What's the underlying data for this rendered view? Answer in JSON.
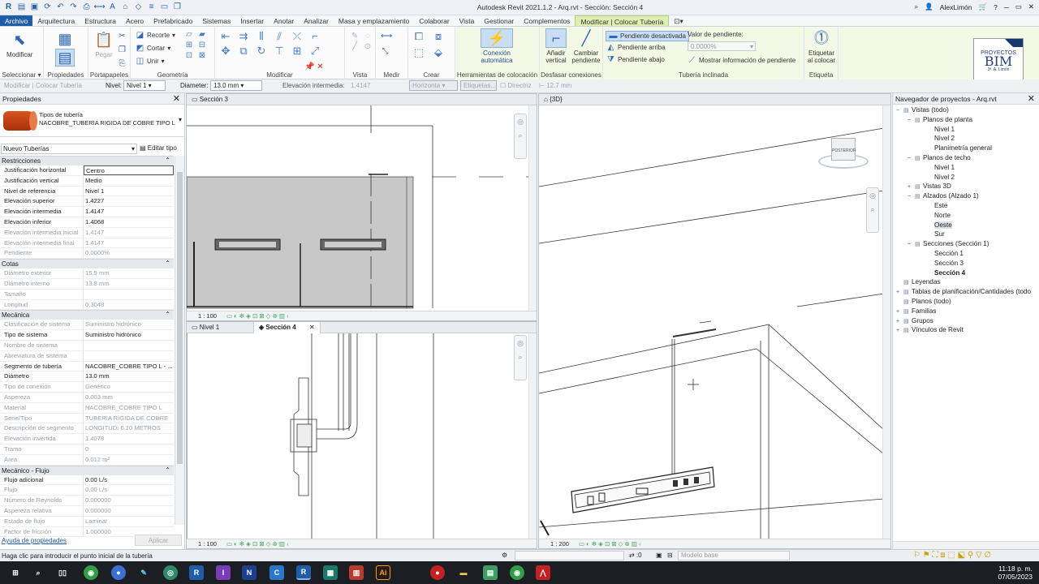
{
  "app": {
    "title": "Autodesk Revit 2021.1.2 - Arq.rvt - Sección: Sección 4",
    "user": "AlexLimón"
  },
  "menu": [
    "Archivo",
    "Arquitectura",
    "Estructura",
    "Acero",
    "Prefabricado",
    "Sistemas",
    "Insertar",
    "Anotar",
    "Analizar",
    "Masa y emplazamiento",
    "Colaborar",
    "Vista",
    "Gestionar",
    "Complementos",
    "Modificar | Colocar Tubería"
  ],
  "ribbon": {
    "modificar": "Modificar",
    "seleccionar": "Seleccionar",
    "propiedades": "Propiedades",
    "portapapeles": "Portapapeles",
    "pegar": "Pegar",
    "recorte": "Recorte",
    "cortar": "Cortar",
    "unir": "Unir",
    "geometria": "Geometría",
    "modificar_grp": "Modificar",
    "vista": "Vista",
    "medir": "Medir",
    "crear": "Crear",
    "conexion_auto": "Conexión automática",
    "herramientas": "Herramientas de colocación",
    "anadir_vertical": "Añadir vertical",
    "cambiar_pendiente": "Cambiar pendiente",
    "desfasar": "Desfasar conexiones",
    "pend_desactivada": "Pendiente desactivada",
    "pend_arriba": "Pendiente arriba",
    "pend_abajo": "Pendiente abajo",
    "valor_pendiente": "Valor de pendiente:",
    "valor_pendiente_val": "0.0000%",
    "mostrar_info": "Mostrar información de pendiente",
    "tuberia_inclinada": "Tubería inclinada",
    "etiquetar": "Etiquetar al colocar",
    "etiqueta": "Etiqueta",
    "logo_line1": "PROYECTOS",
    "logo_line2": "BIM",
    "logo_line3": "3ª. A. Limón"
  },
  "optbar": {
    "context": "Modificar | Colocar Tubería",
    "nivel_label": "Nivel:",
    "nivel": "Nivel 1",
    "diam_label": "Diameter:",
    "diam": "13.0 mm",
    "elev_label": "Elevación intermedia:",
    "elev": "1.4147",
    "horiz": "Horizonta",
    "etiq": "Etiquetas...",
    "directriz": "Directriz",
    "len": "12.7 mm"
  },
  "props": {
    "title": "Propiedades",
    "type_family": "Tipos de tubería",
    "type_name": "NACOBRE_TUBERIA RIGIDA DE COBRE TIPO L",
    "filter": "Nuevo Tuberías",
    "edit_type": "Editar tipo",
    "sections": [
      {
        "name": "Restricciones",
        "rows": [
          [
            "Justificación horizontal",
            "Centro",
            0,
            1
          ],
          [
            "Justificación vertical",
            "Medio",
            0,
            0
          ],
          [
            "Nivel de referencia",
            "Nivel 1",
            0,
            0
          ],
          [
            "Elevación superior",
            "1.4227",
            0,
            0
          ],
          [
            "Elevación intermedia",
            "1.4147",
            0,
            0
          ],
          [
            "Elevación inferior",
            "1.4068",
            0,
            0
          ],
          [
            "Elevación intermedia inicial",
            "1.4147",
            1,
            0
          ],
          [
            "Elevación intermedia final",
            "1.4147",
            1,
            0
          ],
          [
            "Pendiente",
            "0.0000%",
            1,
            0
          ]
        ]
      },
      {
        "name": "Cotas",
        "rows": [
          [
            "Diámetro exterior",
            "15.9 mm",
            1,
            0
          ],
          [
            "Diámetro interno",
            "13.8 mm",
            1,
            0
          ],
          [
            "Tamaño",
            "",
            1,
            0
          ],
          [
            "Longitud",
            "0.3048",
            1,
            0
          ]
        ]
      },
      {
        "name": "Mecánica",
        "rows": [
          [
            "Clasificación de sistema",
            "Suministro hidrónico",
            1,
            0
          ],
          [
            "Tipo de sistema",
            "Suministro hidrónico",
            0,
            0
          ],
          [
            "Nombre de sistema",
            "",
            1,
            0
          ],
          [
            "Abreviatura de sistema",
            "",
            1,
            0
          ],
          [
            "Segmento de tubería",
            "NACOBRE_COBRE TIPO L - ...",
            0,
            0
          ],
          [
            "Diámetro",
            "13.0 mm",
            0,
            0
          ],
          [
            "Tipo de conexión",
            "Genérico",
            1,
            0
          ],
          [
            "Aspereza",
            "0.003 mm",
            1,
            0
          ],
          [
            "Material",
            "NACOBRE_COBRE TIPO L",
            1,
            0
          ],
          [
            "Serie/Tipo",
            "TUBERIA RIGIDA DE COBRE",
            1,
            0
          ],
          [
            "Descripción de segmento",
            "LONGITUD: 6.10 METROS",
            1,
            0
          ],
          [
            "Elevación invertida",
            "1.4078",
            1,
            0
          ],
          [
            "Tramo",
            "0",
            1,
            0
          ],
          [
            "Área",
            "0.012 m²",
            1,
            0
          ]
        ]
      },
      {
        "name": "Mecánico - Flujo",
        "rows": [
          [
            "Flujo adicional",
            "0.00 L/s",
            0,
            0
          ],
          [
            "Flujo",
            "0.00 L/s",
            1,
            0
          ],
          [
            "Número de Reynolds",
            "0.000000",
            1,
            0
          ],
          [
            "Aspereza relativa",
            "0.000000",
            1,
            0
          ],
          [
            "Estado de flujo",
            "Laminar",
            1,
            0
          ],
          [
            "Factor de fricción",
            "1.000000",
            1,
            0
          ]
        ]
      }
    ],
    "help": "Ayuda de propiedades",
    "apply": "Aplicar"
  },
  "views": {
    "v1_tab": "Sección 3",
    "v1_scale": "1 : 100",
    "v2_tab1": "Nivel 1",
    "v2_tab2": "Sección 4",
    "v2_scale": "1 : 100",
    "v3_tab": "{3D}",
    "v3_scale": "1 : 200",
    "viewcube": "POSTERIOR"
  },
  "browser": {
    "title": "Navegador de proyectos - Arq.rvt",
    "nodes": [
      [
        0,
        "−",
        "Vistas (todo)",
        0
      ],
      [
        1,
        "−",
        "Planos de planta",
        0
      ],
      [
        2,
        "",
        "Nivel 1",
        0
      ],
      [
        2,
        "",
        "Nivel 2",
        0
      ],
      [
        2,
        "",
        "Planimetría general",
        0
      ],
      [
        1,
        "−",
        "Planos de techo",
        0
      ],
      [
        2,
        "",
        "Nivel 1",
        0
      ],
      [
        2,
        "",
        "Nivel 2",
        0
      ],
      [
        1,
        "+",
        "Vistas 3D",
        0
      ],
      [
        1,
        "−",
        "Alzados (Alzado 1)",
        0
      ],
      [
        2,
        "",
        "Este",
        0
      ],
      [
        2,
        "",
        "Norte",
        0
      ],
      [
        2,
        "",
        "Oeste",
        2
      ],
      [
        2,
        "",
        "Sur",
        0
      ],
      [
        1,
        "−",
        "Secciones (Sección 1)",
        0
      ],
      [
        2,
        "",
        "Sección 1",
        0
      ],
      [
        2,
        "",
        "Sección 3",
        0
      ],
      [
        2,
        "",
        "Sección 4",
        1
      ],
      [
        0,
        "",
        "Leyendas",
        0
      ],
      [
        0,
        "+",
        "Tablas de planificación/Cantidades (todo",
        0
      ],
      [
        0,
        "",
        "Planos (todo)",
        0
      ],
      [
        0,
        "+",
        "Familias",
        0
      ],
      [
        0,
        "+",
        "Grupos",
        0
      ],
      [
        0,
        "+",
        "Vínculos de Revit",
        0
      ]
    ]
  },
  "status": {
    "hint": "Haga clic para introducir el punto inicial de la tubería",
    "zero": ":0",
    "model": "Modelo base"
  },
  "clock": {
    "time": "11:18 p. m.",
    "date": "07/05/2023"
  }
}
